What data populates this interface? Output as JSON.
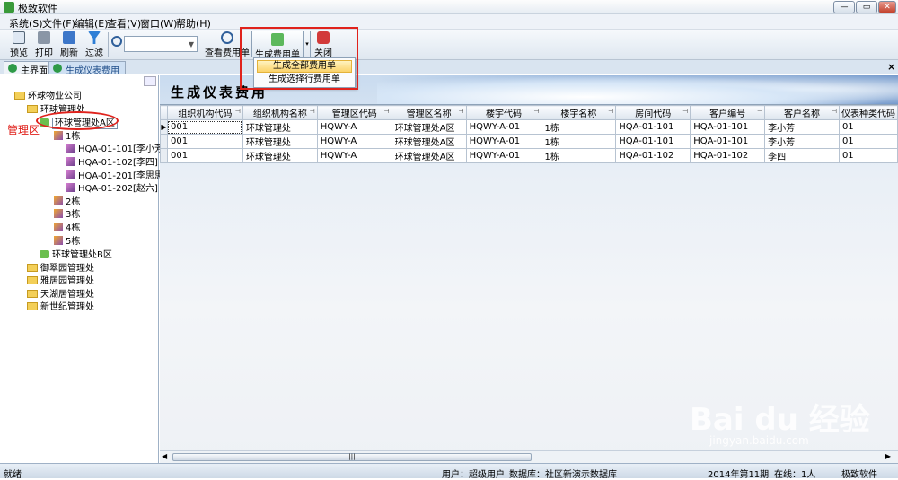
{
  "window": {
    "title": "极致软件",
    "min": "—",
    "max": "▭",
    "close": "✕"
  },
  "menu": [
    "系统(S)",
    "文件(F)",
    "编辑(E)",
    "查看(V)",
    "窗口(W)",
    "帮助(H)"
  ],
  "toolbar": {
    "preview": "预览",
    "print": "打印",
    "refresh": "刷新",
    "filter": "过滤",
    "view_bill": "查看费用单",
    "generate_bill": "生成费用单",
    "close": "关闭"
  },
  "dropdown": {
    "items": [
      "生成全部费用单",
      "生成选择行费用单"
    ]
  },
  "tabs": [
    "主界面",
    "生成仪表费用"
  ],
  "tree": {
    "root": "环球物业公司",
    "office1": "环球管理处",
    "area_a": "环球管理处A区",
    "b1": "1栋",
    "rooms": [
      "HQA-01-101[李小芳]",
      "HQA-01-102[李四]",
      "HQA-01-201[李思思]",
      "HQA-01-202[赵六]"
    ],
    "b2": "2栋",
    "b3": "3栋",
    "b4": "4栋",
    "b5": "5栋",
    "area_b": "环球管理处B区",
    "office2": "御翠园管理处",
    "office3": "雅居园管理处",
    "office4": "天湖居管理处",
    "office5": "新世纪管理处"
  },
  "annotation": "管理区",
  "main": {
    "title": "生成仪表费用"
  },
  "grid": {
    "columns": [
      "组织机构代码",
      "组织机构名称",
      "管理区代码",
      "管理区名称",
      "楼宇代码",
      "楼宇名称",
      "房间代码",
      "客户编号",
      "客户名称",
      "仪表种类代码"
    ],
    "rows": [
      [
        "001",
        "环球管理处",
        "HQWY-A",
        "环球管理处A区",
        "HQWY-A-01",
        "1栋",
        "HQA-01-101",
        "HQA-01-101",
        "李小芳",
        "01"
      ],
      [
        "001",
        "环球管理处",
        "HQWY-A",
        "环球管理处A区",
        "HQWY-A-01",
        "1栋",
        "HQA-01-101",
        "HQA-01-101",
        "李小芳",
        "01"
      ],
      [
        "001",
        "环球管理处",
        "HQWY-A",
        "环球管理处A区",
        "HQWY-A-01",
        "1栋",
        "HQA-01-102",
        "HQA-01-102",
        "李四",
        "01"
      ]
    ]
  },
  "status": {
    "ready": "就绪",
    "user": "用户：超级用户",
    "db": "数据库：社区新演示数据库",
    "period": "2014年第11期",
    "online": "在线：1人",
    "app": "极致软件"
  },
  "scrollbar": {
    "grip": "|||"
  },
  "watermark": {
    "brand": "Bai du 经验",
    "url": "jingyan.baidu.com"
  }
}
